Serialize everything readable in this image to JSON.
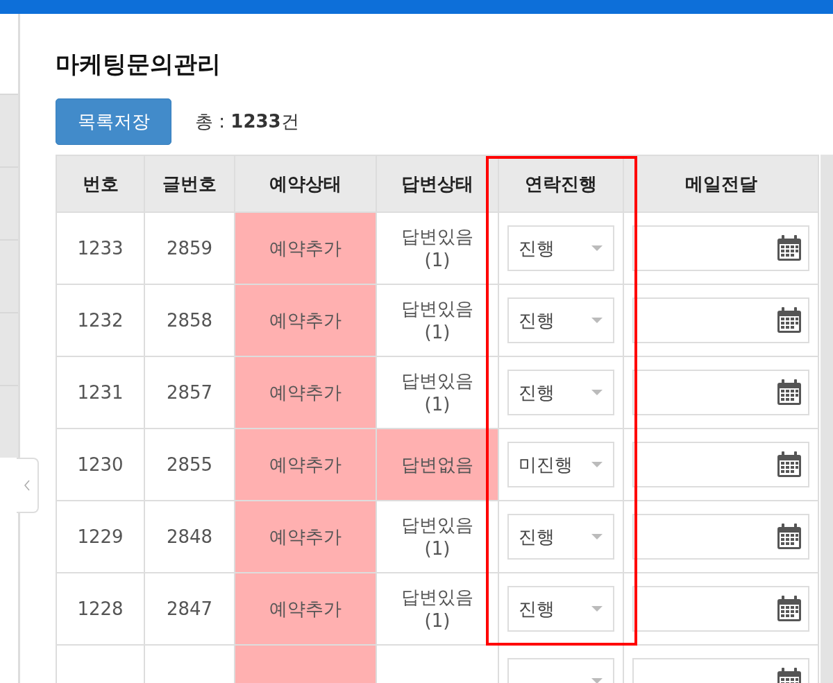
{
  "page": {
    "title": "마케팅문의관리"
  },
  "toolbar": {
    "save_button": "목록저장",
    "total": "총 : **1233**건"
  },
  "sidebar": {
    "items": [
      {
        "selected": false
      },
      {
        "selected": false
      },
      {
        "selected": false
      },
      {
        "selected": false
      },
      {
        "selected": false
      }
    ]
  },
  "annotation": {
    "kind": "highlight-box"
  },
  "table": {
    "columns": [
      "번호",
      "글번호",
      "예약상태",
      "답변상태",
      "연락진행",
      "메일전달"
    ],
    "rows": [
      {
        "number": "1233",
        "post_number": "2859",
        "reservation_status": "예약추가",
        "reservation_highlight": true,
        "answer_status": "답변있음 (1)",
        "answer_highlight": false,
        "contact": "진행",
        "mail_date": ""
      },
      {
        "number": "1232",
        "post_number": "2858",
        "reservation_status": "예약추가",
        "reservation_highlight": true,
        "answer_status": "답변있음 (1)",
        "answer_highlight": false,
        "contact": "진행",
        "mail_date": ""
      },
      {
        "number": "1231",
        "post_number": "2857",
        "reservation_status": "예약추가",
        "reservation_highlight": true,
        "answer_status": "답변있음 (1)",
        "answer_highlight": false,
        "contact": "진행",
        "mail_date": ""
      },
      {
        "number": "1230",
        "post_number": "2855",
        "reservation_status": "예약추가",
        "reservation_highlight": true,
        "answer_status": "답변없음",
        "answer_highlight": true,
        "contact": "미진행",
        "mail_date": ""
      },
      {
        "number": "1229",
        "post_number": "2848",
        "reservation_status": "예약추가",
        "reservation_highlight": true,
        "answer_status": "답변있음 (1)",
        "answer_highlight": false,
        "contact": "진행",
        "mail_date": ""
      },
      {
        "number": "1228",
        "post_number": "2847",
        "reservation_status": "예약추가",
        "reservation_highlight": true,
        "answer_status": "답변있음 (1)",
        "answer_highlight": false,
        "contact": "진행",
        "mail_date": ""
      },
      {
        "reservation_highlight": true,
        "answer_highlight": false
      }
    ]
  }
}
